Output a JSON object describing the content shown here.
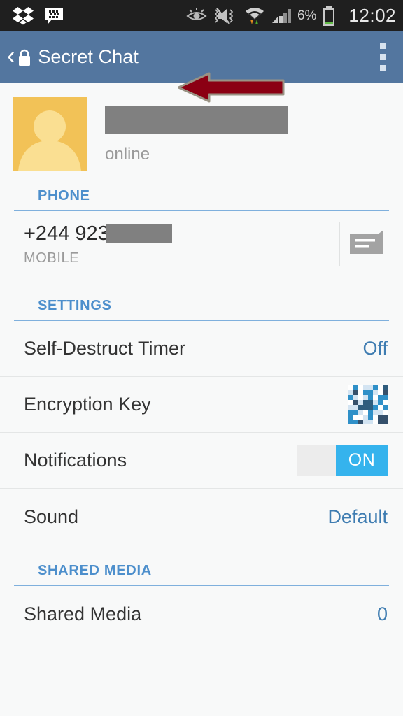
{
  "statusbar": {
    "icons_left": [
      "dropbox-icon",
      "bbm-chat-icon"
    ],
    "icons_right": [
      "smart-stay-eye-icon",
      "sound-mute-vibrate-icon",
      "wifi-data-icon",
      "cellular-signal-icon"
    ],
    "battery_percent": "6%",
    "battery_icon": "battery-low-icon",
    "clock": "12:02"
  },
  "appbar": {
    "back_icon": "back-chevron-icon",
    "lock_icon": "lock-icon",
    "title": "Secret Chat",
    "overflow_icon": "overflow-menu-icon",
    "annotation_icon": "annotation-arrow-icon",
    "bg_color": "#53769f",
    "annotation_color": "#8b0013"
  },
  "profile": {
    "avatar_icon": "avatar-placeholder-icon",
    "avatar_bg_color": "#f2c257",
    "name": "",
    "name_redacted": true,
    "status": "online"
  },
  "sections": {
    "phone": {
      "header": "PHONE",
      "entry": {
        "number": "+244 923",
        "number_redacted": true,
        "type": "MOBILE",
        "action_icon": "message-bubble-icon"
      }
    },
    "settings": {
      "header": "SETTINGS",
      "rows": [
        {
          "label": "Self-Destruct Timer",
          "value": "Off",
          "control": "text"
        },
        {
          "label": "Encryption Key",
          "value": "",
          "control": "identicon"
        },
        {
          "label": "Notifications",
          "value": "ON",
          "control": "toggle",
          "toggle_on": true
        },
        {
          "label": "Sound",
          "value": "Default",
          "control": "text"
        }
      ]
    },
    "shared_media": {
      "header": "SHARED MEDIA",
      "rows": [
        {
          "label": "Shared Media",
          "value": "0"
        }
      ]
    }
  },
  "colors": {
    "accent_blue": "#4d8fcc",
    "value_blue": "#3e7cb1",
    "toggle_on": "#35b3ed",
    "page_bg": "#f8f9f9",
    "redaction_gray": "#808080"
  },
  "identicon_grid": [
    [
      "#ffffff",
      "#2f90c8",
      "#ffffff",
      "#d3e4f2",
      "#d3e4f2",
      "#2f90c8",
      "#ffffff",
      "#2f5d7e"
    ],
    [
      "#d3e4f2",
      "#35506b",
      "#ffffff",
      "#2f90c8",
      "#2f90c8",
      "#d3e4f2",
      "#ffffff",
      "#35506b"
    ],
    [
      "#2f90c8",
      "#d3e4f2",
      "#ffffff",
      "#d3e4f2",
      "#2f90c8",
      "#ffffff",
      "#2f90c8",
      "#2f90c8"
    ],
    [
      "#ffffff",
      "#35506b",
      "#d3e4f2",
      "#2f5d7e",
      "#2f5d7e",
      "#d3e4f2",
      "#2f90c8",
      "#ffffff"
    ],
    [
      "#d3e4f2",
      "#d3e4f2",
      "#2f5d7e",
      "#2f5d7e",
      "#2f5d7e",
      "#2f90c8",
      "#ffffff",
      "#2f90c8"
    ],
    [
      "#2f90c8",
      "#2f90c8",
      "#d3e4f2",
      "#ffffff",
      "#2f90c8",
      "#d3e4f2",
      "#d3e4f2",
      "#ffffff"
    ],
    [
      "#2f90c8",
      "#ffffff",
      "#ffffff",
      "#d3e4f2",
      "#2f90c8",
      "#ffffff",
      "#35506b",
      "#35506b"
    ],
    [
      "#2f90c8",
      "#2f90c8",
      "#35506b",
      "#d3e4f2",
      "#d3e4f2",
      "#ffffff",
      "#35506b",
      "#35506b"
    ]
  ]
}
